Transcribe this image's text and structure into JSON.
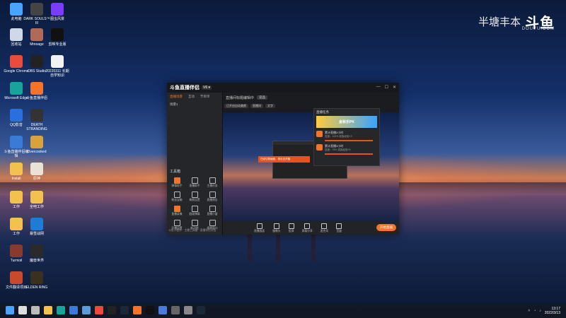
{
  "watermark": {
    "text": "半塘丰本",
    "logo": "斗鱼",
    "sub": "DOUYU.COM"
  },
  "desktop_icons": [
    {
      "label": "此电脑",
      "icon": "monitor-icon",
      "color": "#4aa3ff"
    },
    {
      "label": "DARK SOULS™ III",
      "icon": "dark-souls-icon",
      "color": "#444"
    },
    {
      "label": "图虫风景",
      "icon": "app-icon",
      "color": "#7a3cff"
    },
    {
      "label": "回收站",
      "icon": "recycle-bin-icon",
      "color": "#cfd8e6"
    },
    {
      "label": "Mmoage",
      "icon": "photo-icon",
      "color": "#b06a5a"
    },
    {
      "label": "剪映专业版",
      "icon": "capcut-icon",
      "color": "#111"
    },
    {
      "label": "Google Chrome",
      "icon": "chrome-icon",
      "color": "#e94b3c"
    },
    {
      "label": "OBS Studio",
      "icon": "obs-icon",
      "color": "#222"
    },
    {
      "label": "20220311 长期自学知识",
      "icon": "document-icon",
      "color": "#f2f2f2"
    },
    {
      "label": "Microsoft Edge",
      "icon": "edge-icon",
      "color": "#1aa39a"
    },
    {
      "label": "斗鱼直播伴侣",
      "icon": "douyu-companion-icon",
      "color": "#f5732b"
    },
    {
      "label": "QQ影音",
      "icon": "qq-player-icon",
      "color": "#2a6fe0"
    },
    {
      "label": "DEATH STRANDING",
      "icon": "death-stranding-icon",
      "color": "#333"
    },
    {
      "label": "斗鱼直播伴侣编辑",
      "icon": "app-icon",
      "color": "#3b7bd8"
    },
    {
      "label": "Overcooked",
      "icon": "game-icon",
      "color": "#d9a23a"
    },
    {
      "label": "Install",
      "icon": "folder-icon",
      "color": "#f2c14e"
    },
    {
      "label": "原神",
      "icon": "genshin-icon",
      "color": "#e8e3d4"
    },
    {
      "label": "工作",
      "icon": "folder-icon",
      "color": "#f2c14e"
    },
    {
      "label": "全吧工作",
      "icon": "folder-icon",
      "color": "#f2c14e"
    },
    {
      "label": "工作",
      "icon": "folder-icon",
      "color": "#f2c14e"
    },
    {
      "label": "暴雪战网",
      "icon": "battlenet-icon",
      "color": "#1e7bd8"
    },
    {
      "label": "Turmoil",
      "icon": "turmoil-icon",
      "color": "#8a3a2a"
    },
    {
      "label": "魔兽世界",
      "icon": "wow-icon",
      "color": "#2a2a2a"
    },
    {
      "label": "文件翻译项目",
      "icon": "app-icon",
      "color": "#c84a2a"
    },
    {
      "label": "ELDEN RING",
      "icon": "elden-ring-icon",
      "color": "#3a3020"
    }
  ],
  "app": {
    "brand": "斗鱼直播伴侣",
    "version": "V6 ▾",
    "tabs": [
      "直播场景",
      "互动",
      "节目单"
    ],
    "scene": "场景1",
    "tools_title": "工具箱",
    "tools": [
      "弹幕助手",
      "直播助手",
      "主播任务",
      "粉丝宝箱",
      "美颜设置",
      "直播预告",
      "直播录像",
      "超级弹幕",
      "直播小窗",
      "开播设置",
      "新功能",
      "视频窗口"
    ],
    "bottom_left": "斗鱼小程序 · 主播工具箱 · 直播伴侣公告",
    "main_top": "直播间标题编辑中",
    "main_pill": "竞品",
    "main_top2": [
      "已开启自动美颜",
      "直播间",
      "文字"
    ],
    "toast": "已经切换画面，请点击开播",
    "controls": [
      "直播画面",
      "摄像头",
      "投屏",
      "屏幕分享",
      "麦克风",
      "音量"
    ],
    "go_live": "开始直播"
  },
  "popup": {
    "title": "直播任务",
    "banner": "金秋乐PK",
    "rows": [
      {
        "title": "累计直播2小时",
        "sub": "进度：100%  奖励经验+3"
      },
      {
        "title": "累计直播3小时",
        "sub": "进度：75%  奖励经验+5"
      }
    ]
  },
  "taskbar": {
    "icons": [
      "windows-start-icon",
      "search-icon",
      "taskview-icon",
      "file-explorer-icon",
      "edge-icon",
      "store-icon",
      "mail-icon",
      "chrome-icon",
      "obs-icon",
      "steam-icon",
      "douyu-icon",
      "capcut-icon",
      "photos-icon",
      "app-icon",
      "app-icon",
      "steam-icon"
    ],
    "clock_time": "13:17",
    "clock_date": "2022/3/13"
  }
}
